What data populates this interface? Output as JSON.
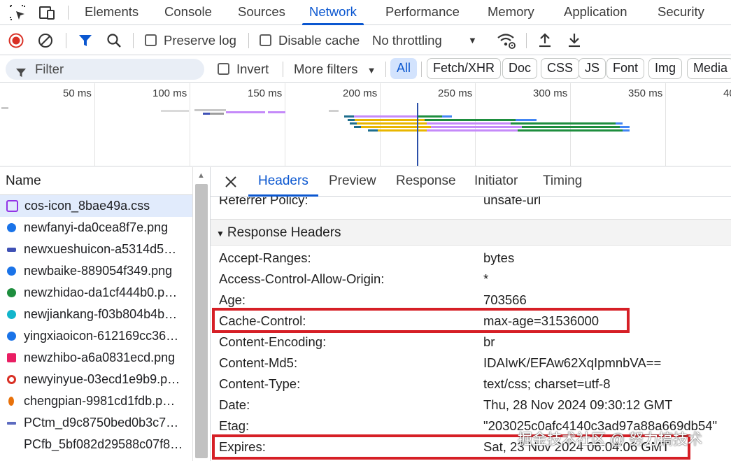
{
  "devtools": {
    "tabs": [
      "Elements",
      "Console",
      "Sources",
      "Network",
      "Performance",
      "Memory",
      "Application",
      "Security"
    ],
    "active_tab": "Network"
  },
  "toolbar": {
    "preserve_log": "Preserve log",
    "disable_cache": "Disable cache",
    "throttling": "No throttling"
  },
  "filter": {
    "placeholder": "Filter",
    "invert": "Invert",
    "more_filters": "More filters",
    "types": [
      "All",
      "Fetch/XHR",
      "Doc",
      "CSS",
      "JS",
      "Font",
      "Img",
      "Media"
    ],
    "selected_type": "All"
  },
  "overview": {
    "ticks": [
      "50 ms",
      "100 ms",
      "150 ms",
      "200 ms",
      "250 ms",
      "300 ms",
      "350 ms",
      "40"
    ]
  },
  "requests": {
    "header": "Name",
    "items": [
      {
        "name": "cos-icon_8bae49a.css",
        "icon_color": "#9334e6"
      },
      {
        "name": "newfanyi-da0cea8f7e.png",
        "icon_color": "#1a73e8"
      },
      {
        "name": "newxueshuicon-a5314d5…",
        "icon_color": "#3f51b5"
      },
      {
        "name": "newbaike-889054f349.png",
        "icon_color": "#1a73e8"
      },
      {
        "name": "newzhidao-da1cf444b0.p…",
        "icon_color": "#1e8e3e"
      },
      {
        "name": "newjiankang-f03b804b4b…",
        "icon_color": "#12b5cb"
      },
      {
        "name": "yingxiaoicon-612169cc36…",
        "icon_color": "#1a73e8"
      },
      {
        "name": "newzhibo-a6a0831ecd.png",
        "icon_color": "#e91e63"
      },
      {
        "name": "newyinyue-03ecd1e9b9.p…",
        "icon_color": "#d93025"
      },
      {
        "name": "chengpian-9981cd1fdb.p…",
        "icon_color": "#e8710a"
      },
      {
        "name": "PCtm_d9c8750bed0b3c7…",
        "icon_color": "#5c6bc0"
      },
      {
        "name": "PCfb_5bf082d29588c07f8…",
        "icon_color": ""
      }
    ]
  },
  "details": {
    "tabs": [
      "Headers",
      "Preview",
      "Response",
      "Initiator",
      "Timing"
    ],
    "active_tab": "Headers",
    "partial_row": {
      "key": "Referrer Policy:",
      "value": "unsafe-url"
    },
    "section_title": "Response Headers",
    "headers": [
      {
        "key": "Accept-Ranges:",
        "value": "bytes"
      },
      {
        "key": "Access-Control-Allow-Origin:",
        "value": "*"
      },
      {
        "key": "Age:",
        "value": "703566"
      },
      {
        "key": "Cache-Control:",
        "value": "max-age=31536000"
      },
      {
        "key": "Content-Encoding:",
        "value": "br"
      },
      {
        "key": "Content-Md5:",
        "value": "IDAIwK/EFAw62XqIpmnbVA=="
      },
      {
        "key": "Content-Type:",
        "value": "text/css; charset=utf-8"
      },
      {
        "key": "Date:",
        "value": "Thu, 28 Nov 2024 09:30:12 GMT"
      },
      {
        "key": "Etag:",
        "value": "\"203025c0afc4140c3ad97a88a669db54\""
      },
      {
        "key": "Expires:",
        "value": "Sat, 23 Nov 2024 06:04:06 GMT"
      }
    ]
  },
  "watermark": "掘金技术社区 @ 努力搞技术",
  "colors": {
    "accent": "#0b57d0",
    "highlight": "#d61f26"
  }
}
